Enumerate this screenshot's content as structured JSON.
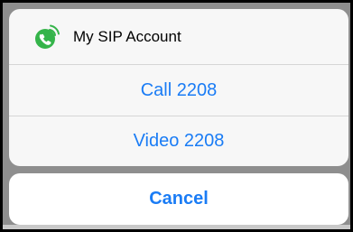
{
  "action_sheet": {
    "account_name": "My SIP Account",
    "app_icon": "phone-wifi-icon",
    "actions": [
      {
        "label": "Call 2208"
      },
      {
        "label": "Video 2208"
      }
    ],
    "cancel_label": "Cancel"
  },
  "colors": {
    "accent": "#1a7cf5",
    "icon_green": "#35b44a",
    "backdrop": "#8e8e8e"
  }
}
